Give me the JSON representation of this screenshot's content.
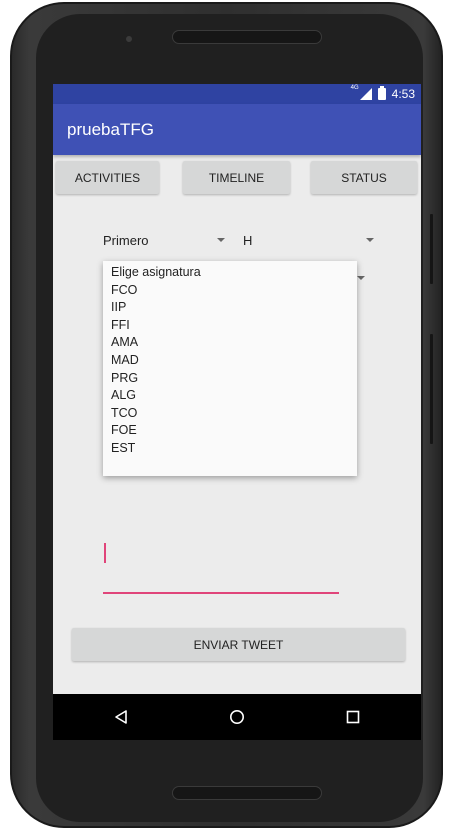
{
  "status_bar": {
    "network": "4G",
    "time": "4:53"
  },
  "app_bar": {
    "title": "pruebaTFG"
  },
  "tabs": {
    "activities": "ACTIVITIES",
    "timeline": "TIMELINE",
    "status": "STATUS"
  },
  "spinners": {
    "course": "Primero",
    "group": "H"
  },
  "dropdown": {
    "items": [
      "Elige asignatura",
      "FCO",
      "IIP",
      "FFI",
      "AMA",
      "MAD",
      "PRG",
      "ALG",
      "TCO",
      "FOE",
      "EST"
    ]
  },
  "tweet_input": {
    "value": ""
  },
  "send_button": "ENVIAR TWEET",
  "navigation": {
    "icons": [
      "back-icon",
      "home-icon",
      "recents-icon"
    ]
  },
  "colors": {
    "status_bar": "#2f43a2",
    "app_bar": "#3f51b5",
    "accent": "#e0457a",
    "button": "#d6d7d7"
  }
}
